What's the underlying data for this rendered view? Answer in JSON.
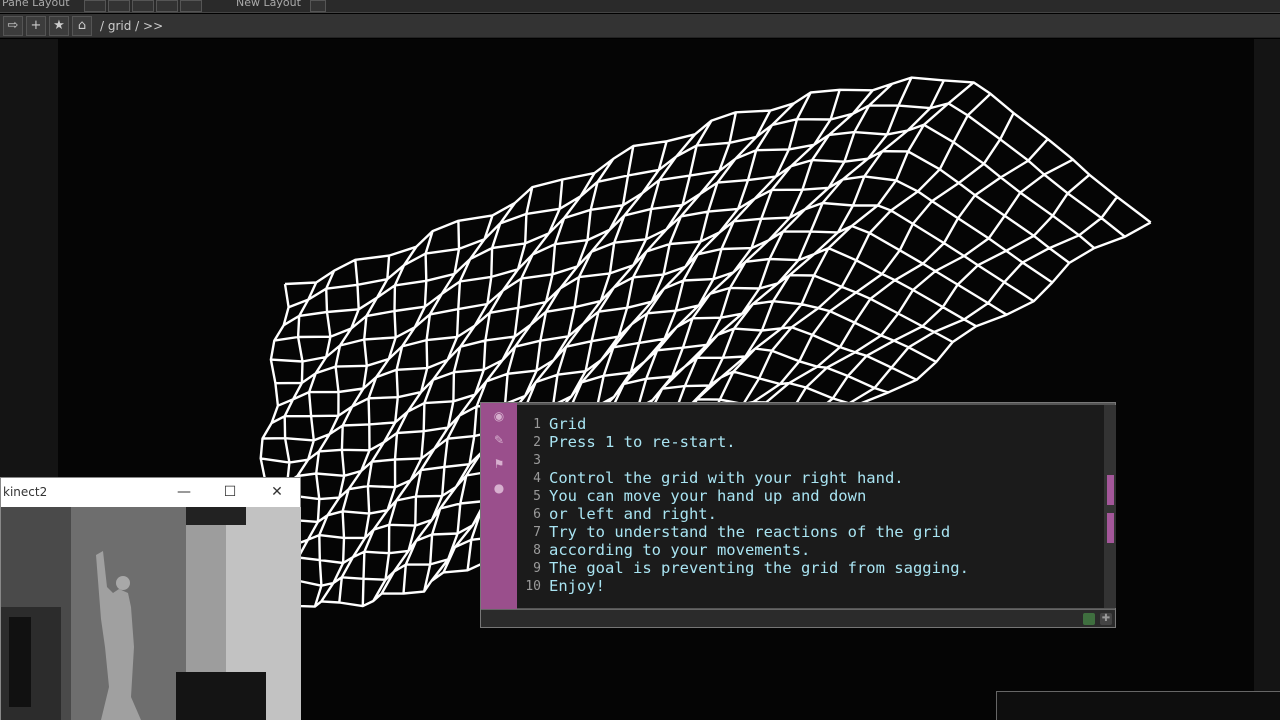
{
  "toolbar": {
    "top_left_label": "Pane Layout",
    "top_mid_label": "New Layout",
    "back_icon": "back-arrow-icon",
    "add_icon": "plus-icon",
    "star_icon": "star-icon",
    "home_icon": "home-icon",
    "path": "/ grid / >>"
  },
  "text_dat": {
    "lines": [
      {
        "n": "1",
        "text": "Grid"
      },
      {
        "n": "2",
        "text": "Press 1 to re-start."
      },
      {
        "n": "3",
        "text": ""
      },
      {
        "n": "4",
        "text": "Control the grid with your right hand."
      },
      {
        "n": "5",
        "text": "You can move your hand up and down"
      },
      {
        "n": "6",
        "text": "or left and right."
      },
      {
        "n": "7",
        "text": "Try to understand the reactions of the grid"
      },
      {
        "n": "8",
        "text": "according to your movements."
      },
      {
        "n": "9",
        "text": "The goal is preventing the grid from sagging."
      },
      {
        "n": "10",
        "text": "Enjoy!"
      }
    ],
    "accent_color": "#9a4f8c",
    "text_color": "#a9e4f2"
  },
  "kinect_window": {
    "title": "kinect2",
    "minimize": "—",
    "maximize": "☐",
    "close": "✕"
  }
}
